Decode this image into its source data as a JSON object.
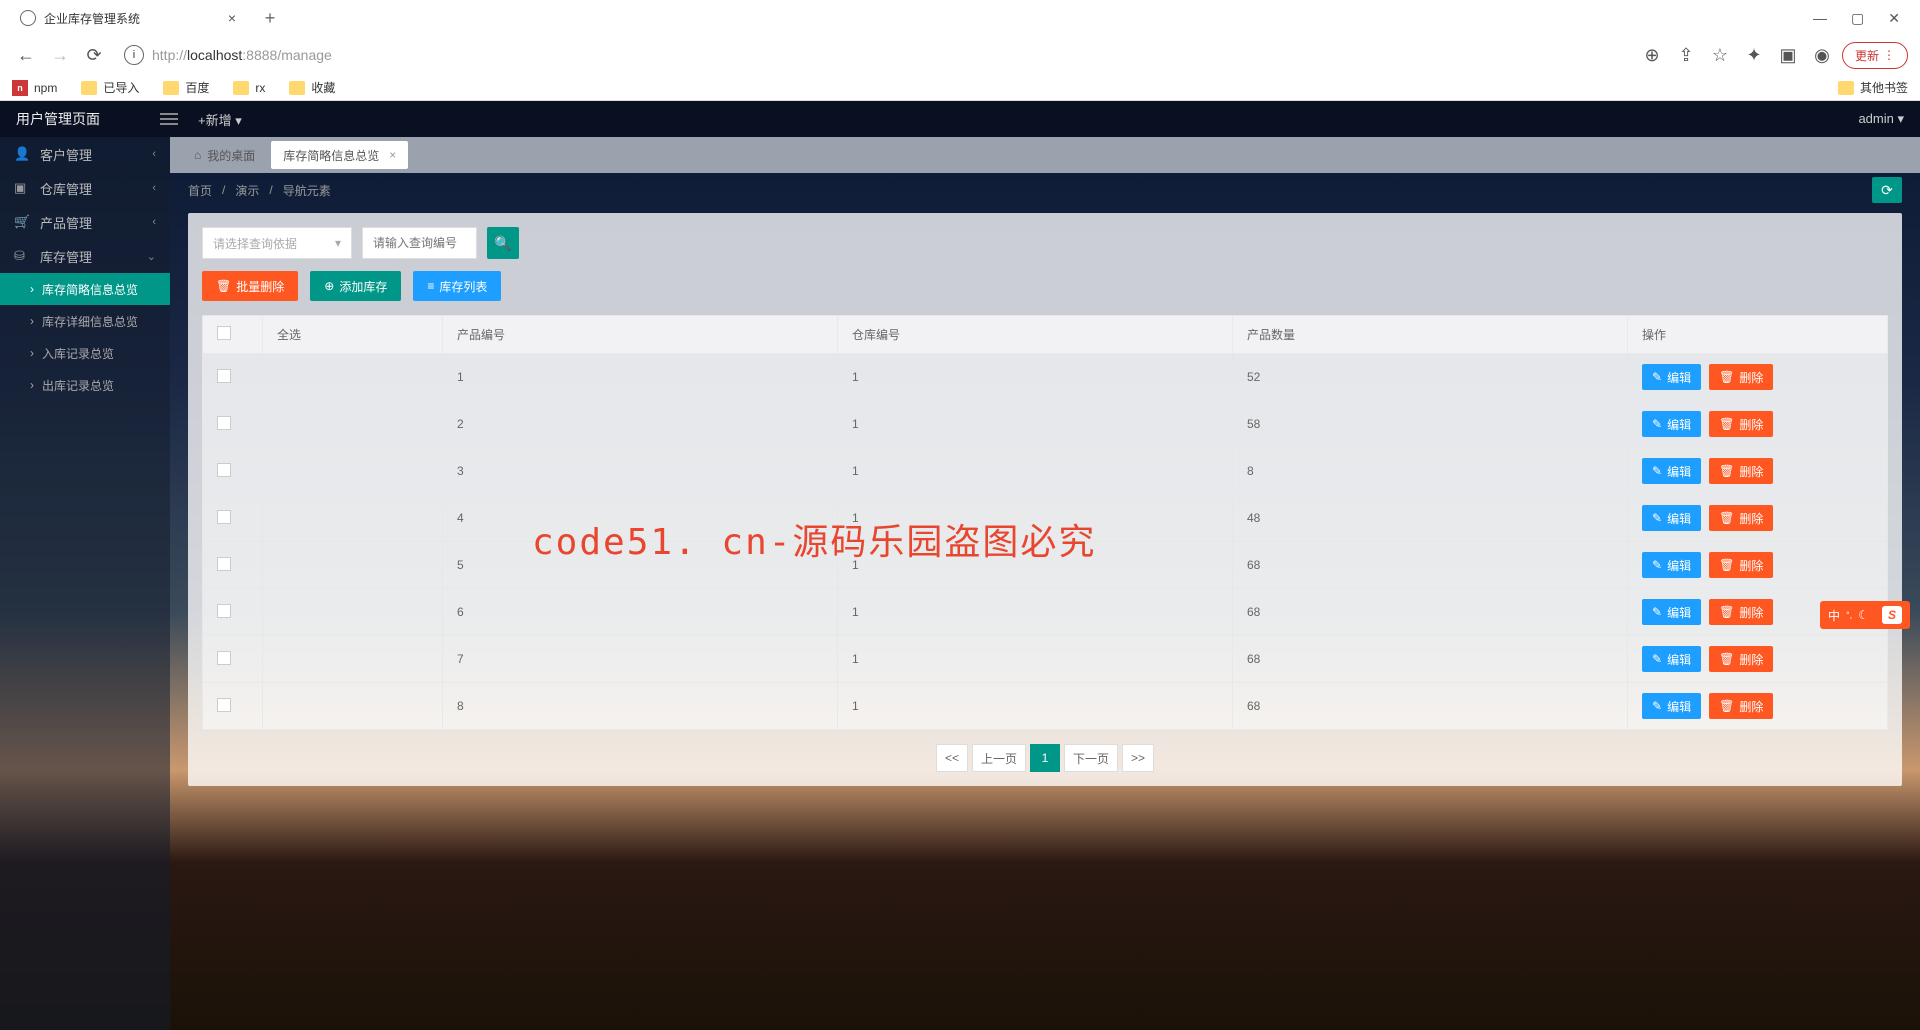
{
  "browser": {
    "tab_title": "企业库存管理系统",
    "url_display": "http://localhost:8888/manage",
    "update_btn": "更新",
    "bookmarks": [
      "npm",
      "已导入",
      "百度",
      "rx",
      "收藏"
    ],
    "other_bookmarks": "其他书签"
  },
  "app_header": {
    "title": "用户管理页面",
    "new_add": "+新增",
    "admin": "admin"
  },
  "sidebar": {
    "items": [
      {
        "label": "客户管理"
      },
      {
        "label": "仓库管理"
      },
      {
        "label": "产品管理"
      },
      {
        "label": "库存管理"
      }
    ],
    "subs": [
      {
        "label": "库存简略信息总览",
        "active": true
      },
      {
        "label": "库存详细信息总览"
      },
      {
        "label": "入库记录总览"
      },
      {
        "label": "出库记录总览"
      }
    ]
  },
  "tabs": [
    {
      "icon": "⌂",
      "label": "我的桌面"
    },
    {
      "label": "库存简略信息总览",
      "active": true
    }
  ],
  "crumbs": {
    "home": "首页",
    "demo": "演示",
    "nav": "导航元素"
  },
  "filters": {
    "select_placeholder": "请选择查询依据",
    "input_placeholder": "请输入查询编号"
  },
  "actions": {
    "batch_delete": "批量删除",
    "add_stock": "添加库存",
    "stock_list": "库存列表"
  },
  "table": {
    "headers": {
      "select_all": "全选",
      "product_id": "产品编号",
      "warehouse_id": "仓库编号",
      "quantity": "产品数量",
      "ops": "操作"
    },
    "edit": "编辑",
    "delete": "删除",
    "rows": [
      {
        "pid": "1",
        "wid": "1",
        "qty": "52"
      },
      {
        "pid": "2",
        "wid": "1",
        "qty": "58"
      },
      {
        "pid": "3",
        "wid": "1",
        "qty": "8"
      },
      {
        "pid": "4",
        "wid": "1",
        "qty": "48"
      },
      {
        "pid": "5",
        "wid": "1",
        "qty": "68"
      },
      {
        "pid": "6",
        "wid": "1",
        "qty": "68"
      },
      {
        "pid": "7",
        "wid": "1",
        "qty": "68"
      },
      {
        "pid": "8",
        "wid": "1",
        "qty": "68"
      }
    ]
  },
  "pager": {
    "first": "<<",
    "prev": "上一页",
    "current": "1",
    "next": "下一页",
    "last": ">>"
  },
  "watermark": "code51. cn-源码乐园盗图必究",
  "ime": {
    "lang": "中"
  }
}
